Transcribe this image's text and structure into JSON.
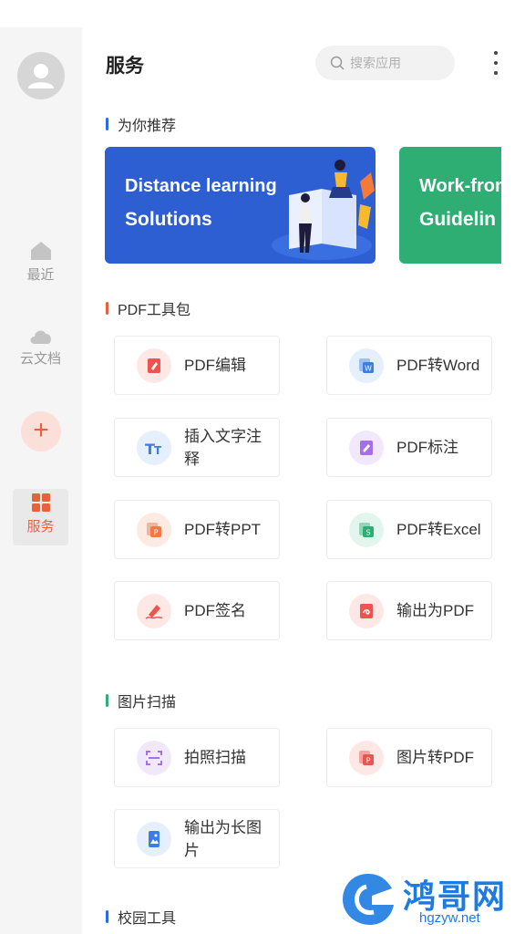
{
  "header": {
    "title": "服务",
    "search_placeholder": "搜索应用"
  },
  "sidebar": {
    "items": [
      {
        "label": "最近",
        "icon": "home-icon"
      },
      {
        "label": "云文档",
        "icon": "cloud-icon"
      },
      {
        "label": "服务",
        "icon": "grid-icon",
        "active": true
      }
    ],
    "add_icon": "plus-icon"
  },
  "sections": {
    "recommend": "为你推荐",
    "pdf_tools": "PDF工具包",
    "image_scan": "图片扫描",
    "campus": "校园工具"
  },
  "banners": [
    {
      "line1": "Distance learning",
      "line2": "Solutions",
      "color": "#2d5fd3"
    },
    {
      "line1": "Work-from",
      "line2": "Guidelin",
      "color": "#2fae73"
    }
  ],
  "pdf_tools": [
    {
      "label": "PDF编辑",
      "icon": "pdf-edit-icon"
    },
    {
      "label": "PDF转Word",
      "icon": "pdf-to-word-icon"
    },
    {
      "label": "插入文字注释",
      "icon": "text-annotation-icon"
    },
    {
      "label": "PDF标注",
      "icon": "pdf-markup-icon"
    },
    {
      "label": "PDF转PPT",
      "icon": "pdf-to-ppt-icon"
    },
    {
      "label": "PDF转Excel",
      "icon": "pdf-to-excel-icon"
    },
    {
      "label": "PDF签名",
      "icon": "pdf-sign-icon"
    },
    {
      "label": "输出为PDF",
      "icon": "export-pdf-icon"
    }
  ],
  "image_tools": [
    {
      "label": "拍照扫描",
      "icon": "photo-scan-icon"
    },
    {
      "label": "图片转PDF",
      "icon": "image-to-pdf-icon"
    },
    {
      "label": "输出为长图片",
      "icon": "long-image-icon"
    }
  ],
  "watermark": {
    "brand": "鸿哥网",
    "url": "hgzyw.net"
  },
  "colors": {
    "accent": "#e8603c",
    "blue": "#2d5fd3",
    "green": "#2fae73"
  }
}
